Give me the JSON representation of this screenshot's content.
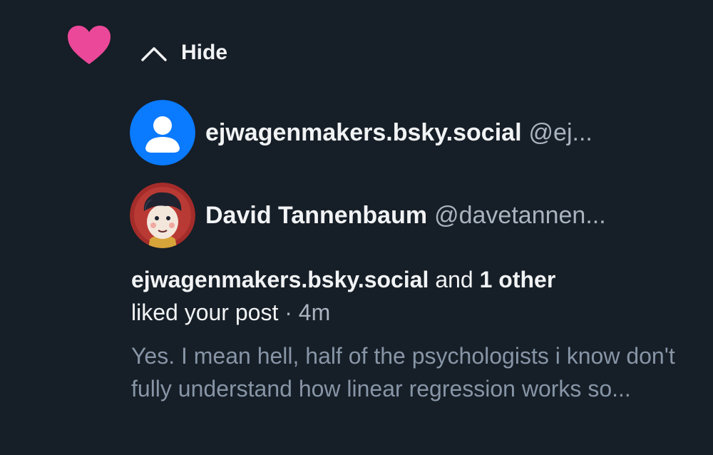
{
  "notification": {
    "type_icon": "heart-icon",
    "accent_color": "#ec4899",
    "hide_label": "Hide",
    "likers": [
      {
        "display_name": "ejwagenmakers.bsky.social",
        "handle": "@ej...",
        "avatar": "default-user-avatar"
      },
      {
        "display_name": "David Tannenbaum",
        "handle": "@davetannen...",
        "avatar": "cartoon-boy-avatar"
      }
    ],
    "summary": {
      "actor": "ejwagenmakers.bsky.social",
      "connector": " and ",
      "others": "1 other",
      "action": "liked your post",
      "separator": " · ",
      "time": "4m"
    },
    "post_preview": "Yes. I mean hell, half of the psychologists i know don't fully understand how linear regression works so..."
  }
}
